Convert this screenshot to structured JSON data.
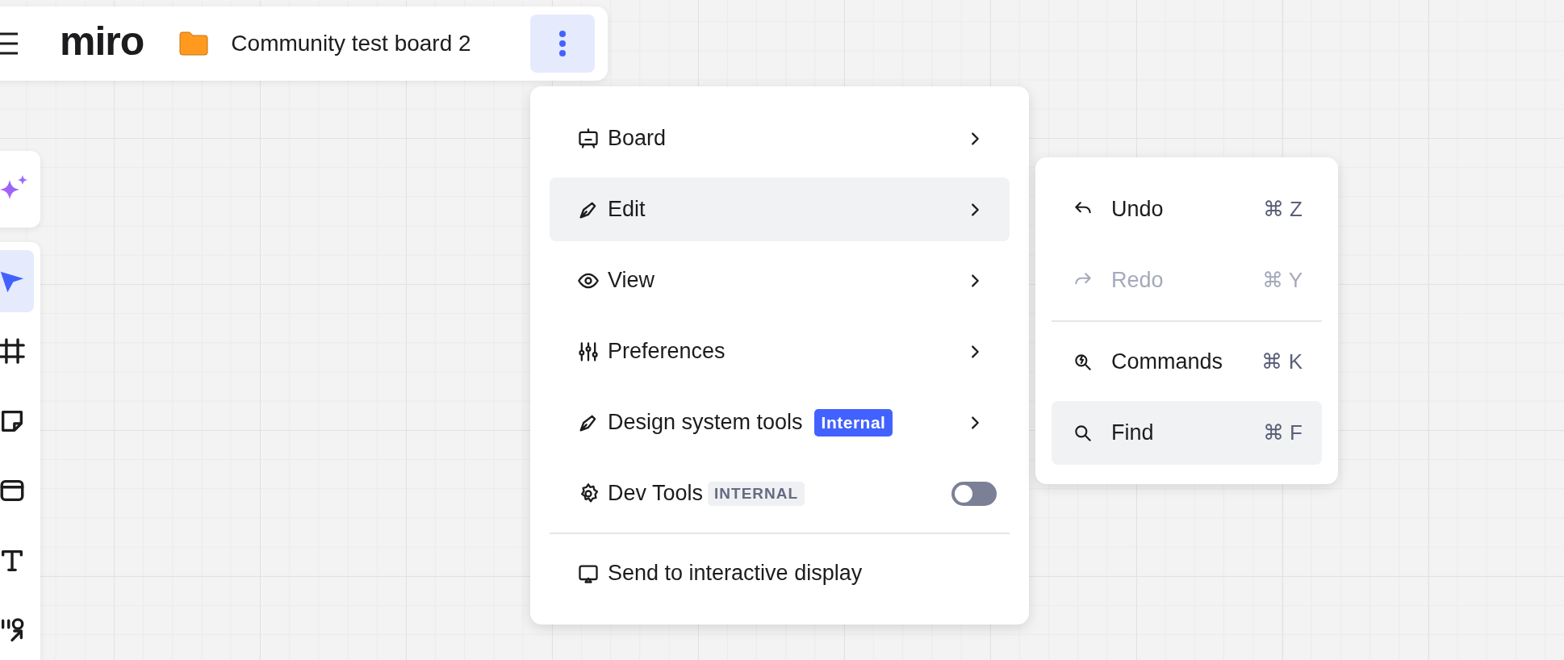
{
  "header": {
    "logo": "miro",
    "board_title": "Community test board 2",
    "more_button_active": true
  },
  "toolbar": {
    "tools": [
      {
        "selected": true
      },
      {
        "selected": false
      },
      {
        "selected": false
      },
      {
        "selected": false
      },
      {
        "selected": false
      },
      {
        "selected": false
      }
    ]
  },
  "menu": {
    "sections": [
      [
        {
          "label": "Board",
          "kind": "submenu",
          "highlighted": false
        },
        {
          "label": "Edit",
          "kind": "submenu",
          "highlighted": true
        },
        {
          "label": "View",
          "kind": "submenu",
          "highlighted": false
        },
        {
          "label": "Preferences",
          "kind": "submenu",
          "highlighted": false
        },
        {
          "label": "Design system tools",
          "kind": "submenu",
          "highlighted": false,
          "badge": {
            "text": "Internal",
            "kind": "solid"
          }
        },
        {
          "label": "Dev Tools",
          "kind": "toggle",
          "highlighted": false,
          "on": false,
          "badge": {
            "text": "INTERNAL",
            "kind": "subtle"
          }
        }
      ],
      [
        {
          "label": "Send to interactive display",
          "kind": "action",
          "highlighted": false
        }
      ]
    ]
  },
  "submenu": {
    "sections": [
      [
        {
          "label": "Undo",
          "shortcut": "⌘ Z",
          "disabled": false,
          "highlighted": false
        },
        {
          "label": "Redo",
          "shortcut": "⌘ Y",
          "disabled": true,
          "highlighted": false
        }
      ],
      [
        {
          "label": "Commands",
          "shortcut": "⌘ K",
          "disabled": false,
          "highlighted": false
        },
        {
          "label": "Find",
          "shortcut": "⌘ F",
          "disabled": false,
          "highlighted": true
        }
      ]
    ]
  }
}
